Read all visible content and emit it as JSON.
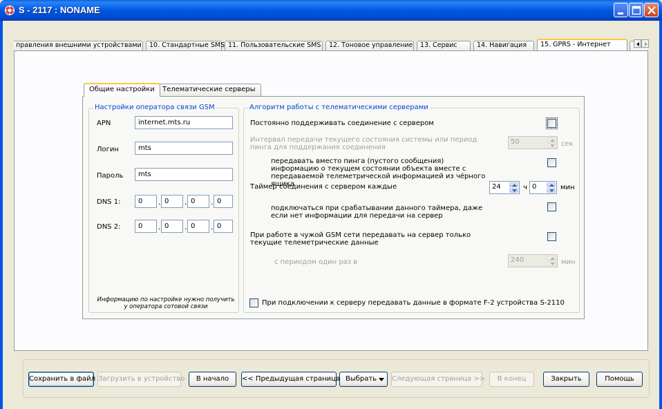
{
  "window": {
    "title": "S - 2117 : NONAME"
  },
  "top_tabs": [
    {
      "label": "правления внешними устройствами"
    },
    {
      "label": "10. Стандартные SMS"
    },
    {
      "label": "11. Пользовательские SMS"
    },
    {
      "label": "12. Тоновое управление"
    },
    {
      "label": "13. Сервис"
    },
    {
      "label": "14. Навигация"
    },
    {
      "label": "15. GPRS - Интернет"
    }
  ],
  "inner_tabs": [
    {
      "label": "Общие настройки"
    },
    {
      "label": "Телематические серверы"
    }
  ],
  "gsm": {
    "title": "Настройки оператора связи GSM",
    "apn_label": "APN",
    "apn_value": "internet.mts.ru",
    "login_label": "Логин",
    "login_value": "mts",
    "password_label": "Пароль",
    "password_value": "mts",
    "dns1_label": "DNS 1:",
    "dns1": [
      "0",
      "0",
      "0",
      "0"
    ],
    "dns2_label": "DNS 2:",
    "dns2": [
      "0",
      "0",
      "0",
      "0"
    ],
    "note": "Информацию по настройке нужно получить у оператора сотовой связи"
  },
  "algo": {
    "title": "Алгоритм работы с телематическими серверами",
    "keep_connection": "Постоянно поддерживать соединение с сервером",
    "interval_label": "Интервал передачи текущего состояния системы или период пинга для поддержания соединения",
    "interval_value": "50",
    "interval_unit": "сек",
    "send_instead_ping": "передавать вместо пинга (пустого сообщения) информацию о текущем состоянии объекта вместе с передаваемой телеметрической информацией из чёрного ящика",
    "timer_label": "Таймер соединения с сервером каждые",
    "timer_hours": "24",
    "timer_h_unit": "ч",
    "timer_minutes": "0",
    "timer_m_unit": "мин",
    "connect_on_timer": "подключаться при срабатывании данного таймера, даже если нет информации для передачи на сервер",
    "foreign_gsm": "При работе в чужой GSM сети передавать на сервер только текущие телеметрические данные",
    "period_label": "с периодом один раз в",
    "period_value": "240",
    "period_unit": "мин",
    "f2_format": "При подключении к серверу передавать данные в формате F-2 устройства S-2110"
  },
  "buttons": {
    "save": "Сохранить в файл",
    "load": "Загрузить в устройство",
    "start": "В начало",
    "prev": "<< Предыдущая страница",
    "select": "Выбрать",
    "next": "Следующая страница >>",
    "end": "В конец",
    "close": "Закрыть",
    "help": "Помощь"
  },
  "icons": {
    "app": "app-icon",
    "minimize": "minimize-icon",
    "maximize": "maximize-icon",
    "close": "close-icon",
    "dropdown": "triangle-down-icon"
  }
}
